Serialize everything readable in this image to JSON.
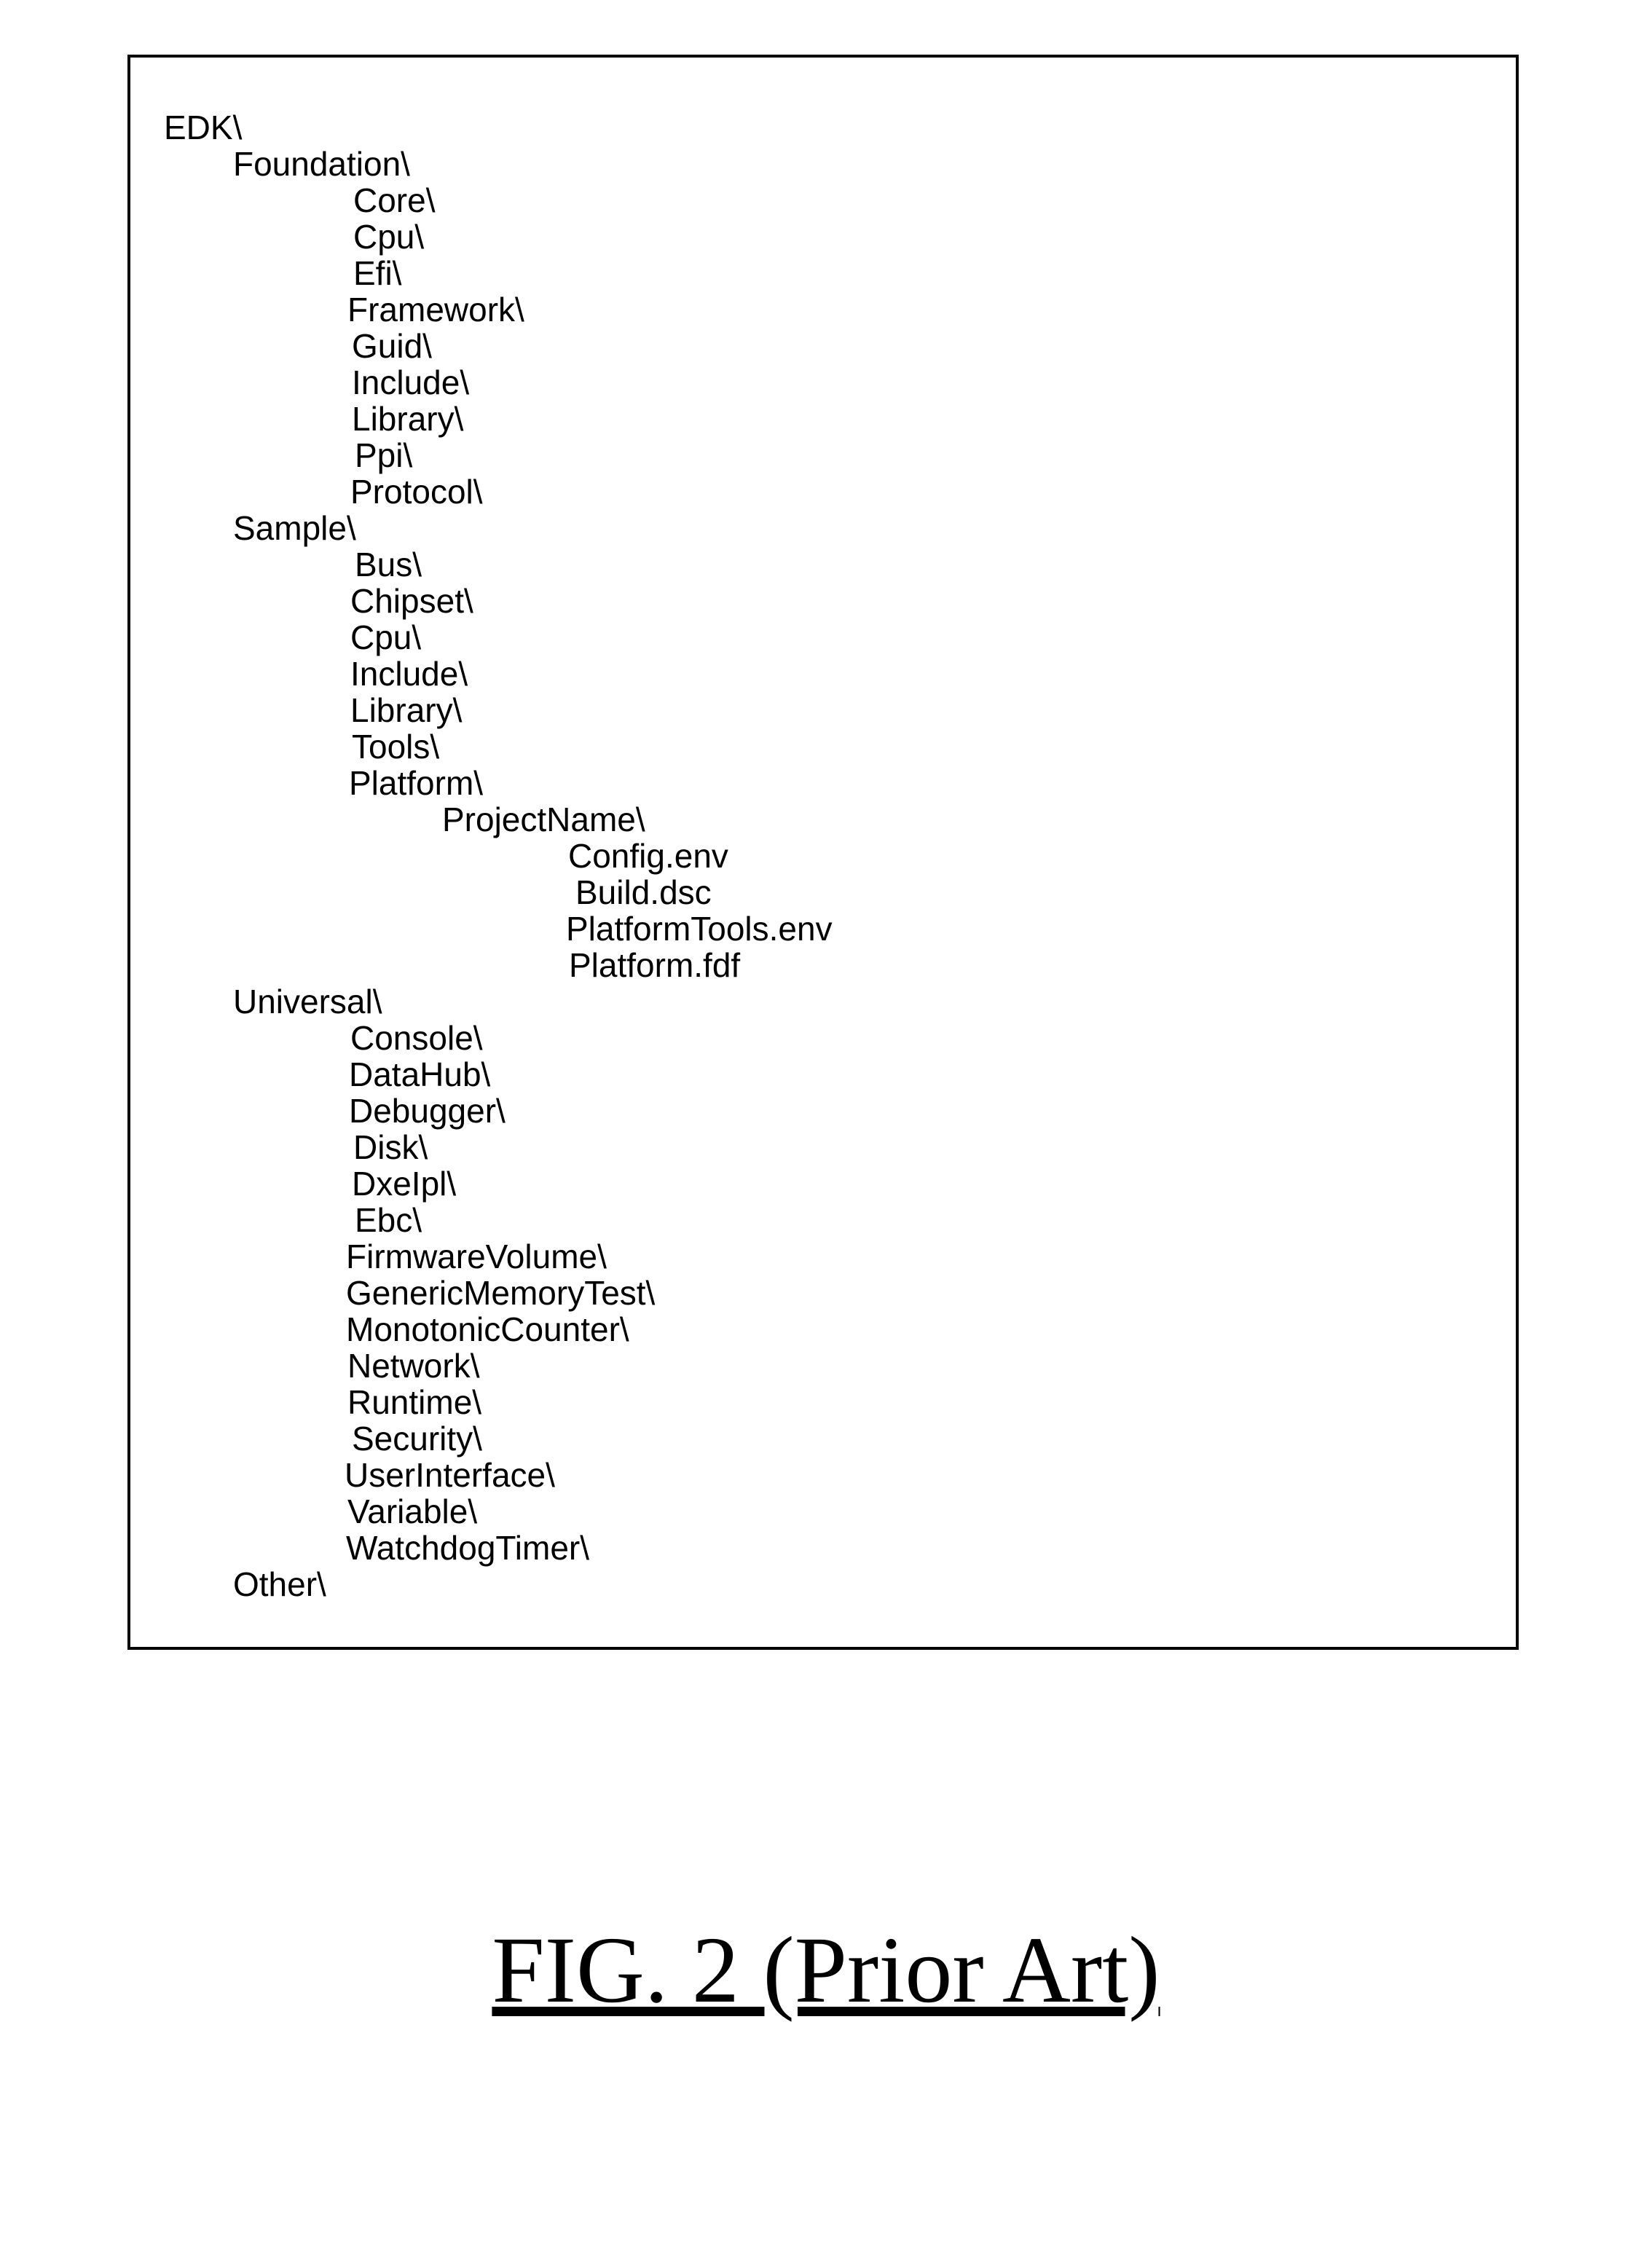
{
  "caption": "FIG. 2 (Prior Art)",
  "tree": {
    "root": "EDK\\",
    "level1": {
      "foundation": "Foundation\\",
      "sample": "Sample\\",
      "universal": "Universal\\",
      "other": "Other\\"
    },
    "foundation_items": {
      "core": "Core\\",
      "cpu": "Cpu\\",
      "efi": "Efi\\",
      "framework": "Framework\\",
      "guid": "Guid\\",
      "include": "Include\\",
      "library": "Library\\",
      "ppi": "Ppi\\",
      "protocol": "Protocol\\"
    },
    "sample_items": {
      "bus": "Bus\\",
      "chipset": "Chipset\\",
      "cpu": "Cpu\\",
      "include": "Include\\",
      "library": "Library\\",
      "tools": "Tools\\",
      "platform": "Platform\\"
    },
    "platform_items": {
      "projectname": "ProjectName\\"
    },
    "projectname_items": {
      "config": "Config.env",
      "build": "Build.dsc",
      "platformtools": "PlatformTools.env",
      "platformfdf": "Platform.fdf"
    },
    "universal_items": {
      "console": "Console\\",
      "datahub": "DataHub\\",
      "debugger": "Debugger\\",
      "disk": "Disk\\",
      "dxeipl": "DxeIpl\\",
      "ebc": "Ebc\\",
      "firmwarevolume": "FirmwareVolume\\",
      "genericmemorytest": "GenericMemoryTest\\",
      "monotoniccounter": "MonotonicCounter\\",
      "network": "Network\\",
      "runtime": "Runtime\\",
      "security": "Security\\",
      "userinterface": "UserInterface\\",
      "variable": "Variable\\",
      "watchdogtimer": "WatchdogTimer\\"
    }
  }
}
